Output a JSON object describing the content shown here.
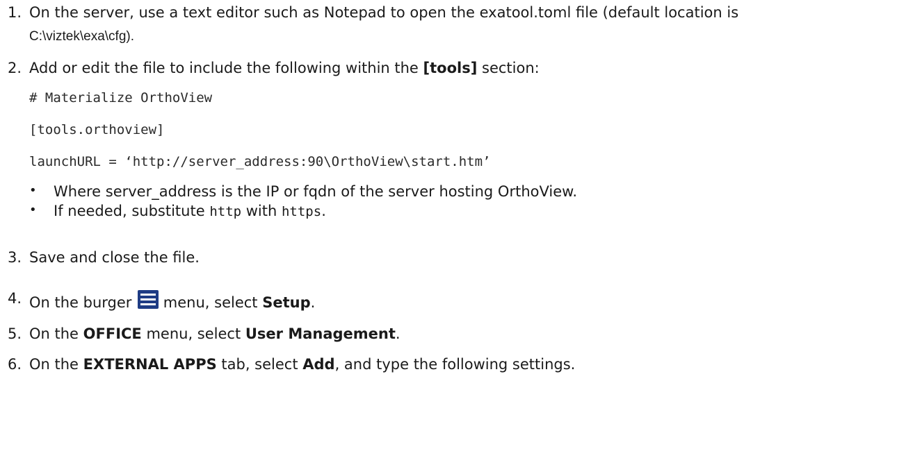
{
  "steps": [
    {
      "num": "1.",
      "line1": "On the server, use a text editor such as Notepad to open the exatool.toml file (default location is",
      "line2": "C:\\viztek\\exa\\cfg)."
    },
    {
      "num": "2.",
      "pre": "Add or edit the file to include the following within the ",
      "bold": "[tools]",
      "post": " section:",
      "code": [
        "# Materialize OrthoView",
        "[tools.orthoview]",
        "launchURL = ‘http://server_address:90\\OrthoView\\start.htm’"
      ],
      "bullets": [
        {
          "text": "Where server_address is the IP or fqdn of the server hosting OrthoView."
        },
        {
          "pre": "If needed, substitute ",
          "code1": "http",
          "mid": " with ",
          "code2": "https",
          "post": "."
        }
      ]
    },
    {
      "num": "3.",
      "text": "Save and close the file."
    },
    {
      "num": "4.",
      "pre": "On the burger ",
      "mid": " menu, select ",
      "bold": "Setup",
      "post": "."
    },
    {
      "num": "5.",
      "pre": "On the ",
      "bold1": "OFFICE",
      "mid": " menu, select ",
      "bold2": "User Management",
      "post": "."
    },
    {
      "num": "6.",
      "pre": "On the ",
      "bold1": "EXTERNAL APPS",
      "mid1": " tab, select ",
      "bold2": "Add",
      "post": ", and type the following settings."
    }
  ],
  "icons": {
    "burger": "burger-menu-icon"
  },
  "colors": {
    "text": "#1a1a1a",
    "burger_icon": "#1e3c84"
  }
}
